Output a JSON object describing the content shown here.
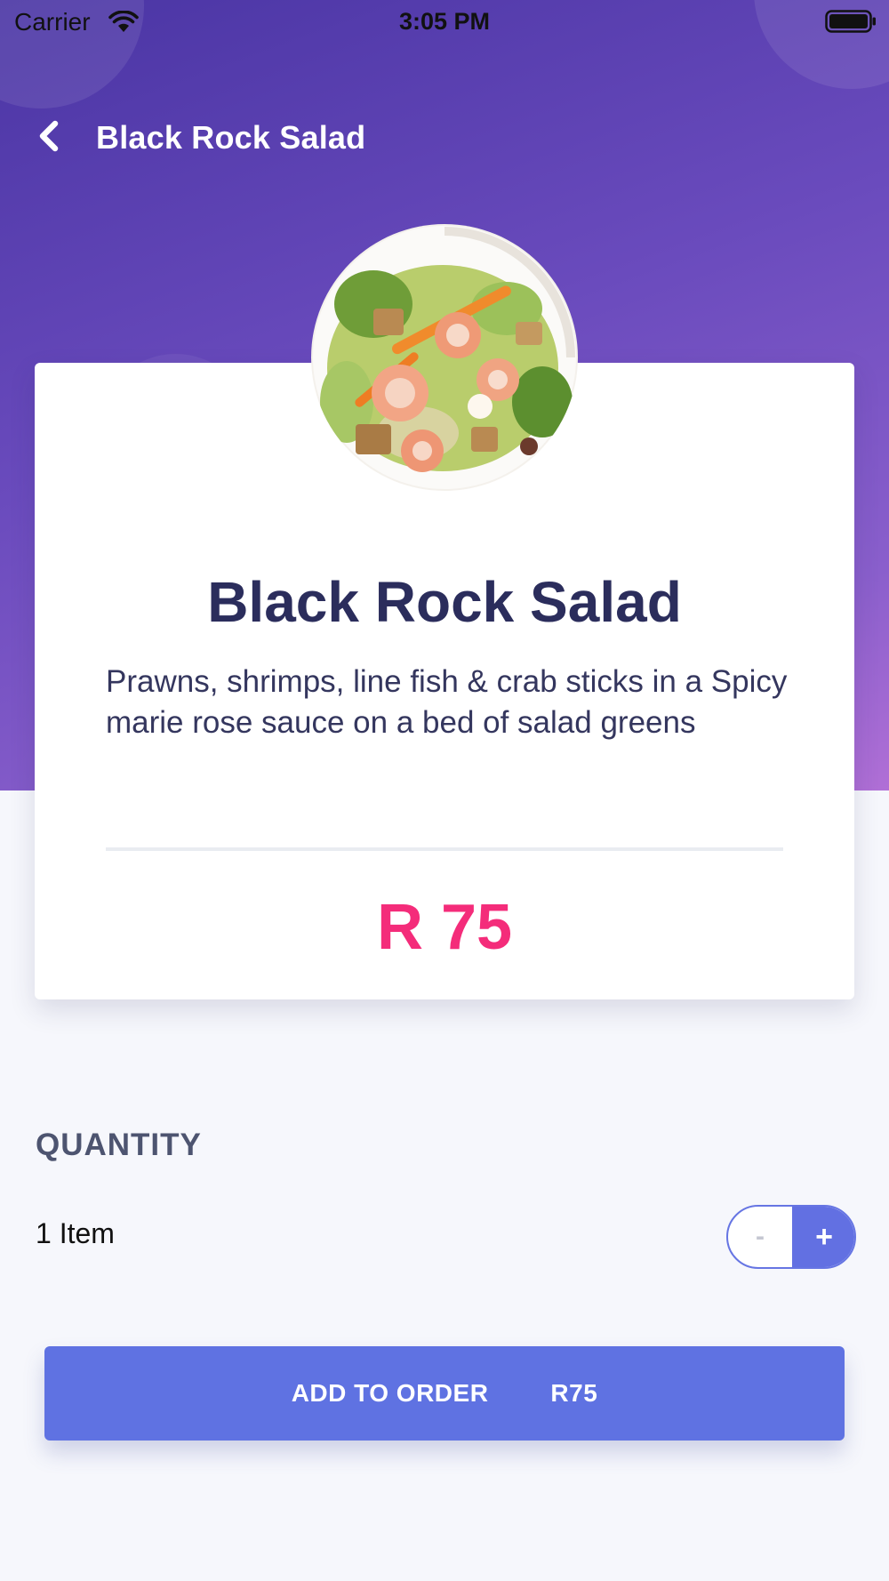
{
  "status_bar": {
    "carrier": "Carrier",
    "time": "3:05 PM",
    "icons": [
      "wifi-icon",
      "battery-icon"
    ]
  },
  "nav": {
    "back_icon": "chevron-left-icon",
    "title": "Black Rock Salad"
  },
  "item": {
    "image_alt": "prawn salad photo",
    "name": "Black Rock Salad",
    "description": "Prawns, shrimps, line fish & crab sticks in a Spicy marie rose sauce on a bed of salad greens",
    "price": "R 75"
  },
  "quantity": {
    "heading": "QUANTITY",
    "value": "1 Item",
    "minus_label": "-",
    "plus_label": "+"
  },
  "add_button": {
    "label": "ADD TO ORDER",
    "total": "R75"
  },
  "colors": {
    "header_gradient_start": "#4a35a4",
    "header_gradient_end": "#b06fd6",
    "title_text": "#2b2d5c",
    "price": "#f42c7a",
    "accent": "#5f72e2",
    "background": "#f6f7fc"
  }
}
